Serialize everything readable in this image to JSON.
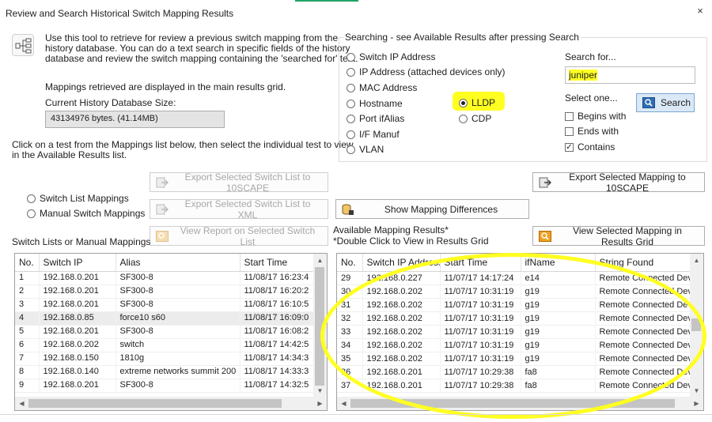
{
  "window": {
    "title": "Review and Search Historical Switch Mapping Results",
    "close_icon": "×"
  },
  "intro": {
    "line1": "Use this tool to retrieve for review a previous switch mapping from the",
    "line2": "history database. You can do a text search in specific fields of the history",
    "line3": "database and review the switch mapping containing the 'searched for' text.",
    "mappings_note": "Mappings retrieved are displayed in the main results grid.",
    "db_size_label": "Current History Database Size:",
    "db_size_value": "43134976 bytes. (41.14MB)",
    "click_hint1": "Click on a test from the Mappings list below, then select the individual test to view",
    "click_hint2": "in the Available Results list."
  },
  "search_group": {
    "legend": "Searching - see Available Results after pressing Search",
    "fields": [
      {
        "label": "Switch IP Address",
        "selected": false
      },
      {
        "label": "IP Address (attached devices only)",
        "selected": false
      },
      {
        "label": "MAC Address",
        "selected": false
      },
      {
        "label": "Hostname",
        "selected": false
      },
      {
        "label": "Port ifAlias",
        "selected": false
      },
      {
        "label": "I/F Manuf",
        "selected": false
      },
      {
        "label": "VLAN",
        "selected": false
      }
    ],
    "lldp": {
      "label": "LLDP",
      "selected": true
    },
    "cdp": {
      "label": "CDP",
      "selected": false
    },
    "search_for_label": "Search for...",
    "search_value": "juniper",
    "select_one_label": "Select one...",
    "begins_with": {
      "label": "Begins with",
      "checked": false
    },
    "ends_with": {
      "label": "Ends with",
      "checked": false
    },
    "contains": {
      "label": "Contains",
      "checked": true
    },
    "search_button": "Search"
  },
  "mode": {
    "switch_list": "Switch List Mappings",
    "manual": "Manual Switch Mappings"
  },
  "buttons": {
    "export_switch_list_10scape": "Export Selected Switch List to 10SCAPE",
    "export_mapping_10scape": "Export Selected Mapping to 10SCAPE",
    "export_switch_list_xml": "Export Selected Switch List to XML",
    "show_differences": "Show Mapping Differences",
    "view_report": "View Report on Selected Switch List",
    "view_mapping_grid": "View Selected Mapping in Results Grid"
  },
  "left_list": {
    "caption": "Switch Lists or Manual Mappings",
    "columns": [
      "No.",
      "Switch IP",
      "Alias",
      "Start Time"
    ],
    "rows": [
      [
        "1",
        "192.168.0.201",
        "SF300-8",
        "11/08/17 16:23:4"
      ],
      [
        "2",
        "192.168.0.201",
        "SF300-8",
        "11/08/17 16:20:2"
      ],
      [
        "3",
        "192.168.0.201",
        "SF300-8",
        "11/08/17 16:10:5"
      ],
      [
        "4",
        "192.168.0.85",
        "force10 s60",
        "11/08/17 16:09:0"
      ],
      [
        "5",
        "192.168.0.201",
        "SF300-8",
        "11/08/17 16:08:2"
      ],
      [
        "6",
        "192.168.0.202",
        "switch",
        "11/08/17 14:42:5"
      ],
      [
        "7",
        "192.168.0.150",
        "1810g",
        "11/08/17 14:34:3"
      ],
      [
        "8",
        "192.168.0.140",
        "extreme networks summit 200",
        "11/08/17 14:33:3"
      ],
      [
        "9",
        "192.168.0.201",
        "SF300-8",
        "11/08/17 14:32:5"
      ]
    ],
    "selected_row": 3
  },
  "right_list": {
    "caption1": "Available Mapping Results*",
    "caption2": "*Double Click to View in Results Grid",
    "columns": [
      "No.",
      "Switch IP Address",
      "Start Time",
      "ifName",
      "String Found"
    ],
    "rows": [
      [
        "29",
        "192.168.0.227",
        "11/07/17 14:17:24",
        "e14",
        "Remote Connected Dev"
      ],
      [
        "30",
        "192.168.0.202",
        "11/07/17 10:31:19",
        "g19",
        "Remote Connected Dev"
      ],
      [
        "31",
        "192.168.0.202",
        "11/07/17 10:31:19",
        "g19",
        "Remote Connected Dev"
      ],
      [
        "32",
        "192.168.0.202",
        "11/07/17 10:31:19",
        "g19",
        "Remote Connected Dev"
      ],
      [
        "33",
        "192.168.0.202",
        "11/07/17 10:31:19",
        "g19",
        "Remote Connected Dev"
      ],
      [
        "34",
        "192.168.0.202",
        "11/07/17 10:31:19",
        "g19",
        "Remote Connected Dev"
      ],
      [
        "35",
        "192.168.0.202",
        "11/07/17 10:31:19",
        "g19",
        "Remote Connected Dev"
      ],
      [
        "36",
        "192.168.0.201",
        "11/07/17 10:29:38",
        "fa8",
        "Remote Connected Dev"
      ],
      [
        "37",
        "192.168.0.201",
        "11/07/17 10:29:38",
        "fa8",
        "Remote Connected Dev"
      ]
    ]
  },
  "colors": {
    "highlight": "#ffff22",
    "excel_green": "#21a366"
  }
}
